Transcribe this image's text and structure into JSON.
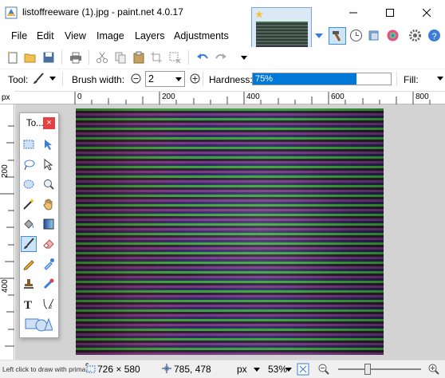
{
  "window": {
    "title": "listoffreeware (1).jpg - paint.net 4.0.17"
  },
  "menu": {
    "items": [
      "File",
      "Edit",
      "View",
      "Image",
      "Layers",
      "Adjustments"
    ]
  },
  "options": {
    "tool_label": "Tool:",
    "brush_width_label": "Brush width:",
    "brush_width_value": "2",
    "hardness_label": "Hardness:",
    "hardness_value": "75%",
    "hardness_fraction": 0.75,
    "fill_label": "Fill:"
  },
  "ruler_top": {
    "labels": [
      "0",
      "200",
      "400",
      "600",
      "800"
    ]
  },
  "ruler_left": {
    "labels": [
      "200",
      "400"
    ],
    "unit": "px"
  },
  "tools_window": {
    "title": "To...",
    "close": "×"
  },
  "status": {
    "hint": "Left click to draw with prima...",
    "image_size": "726 × 580",
    "cursor_pos": "785, 478",
    "unit": "px",
    "zoom": "53%"
  },
  "colors": {
    "accent": "#0078d7",
    "close_red": "#e04343"
  }
}
